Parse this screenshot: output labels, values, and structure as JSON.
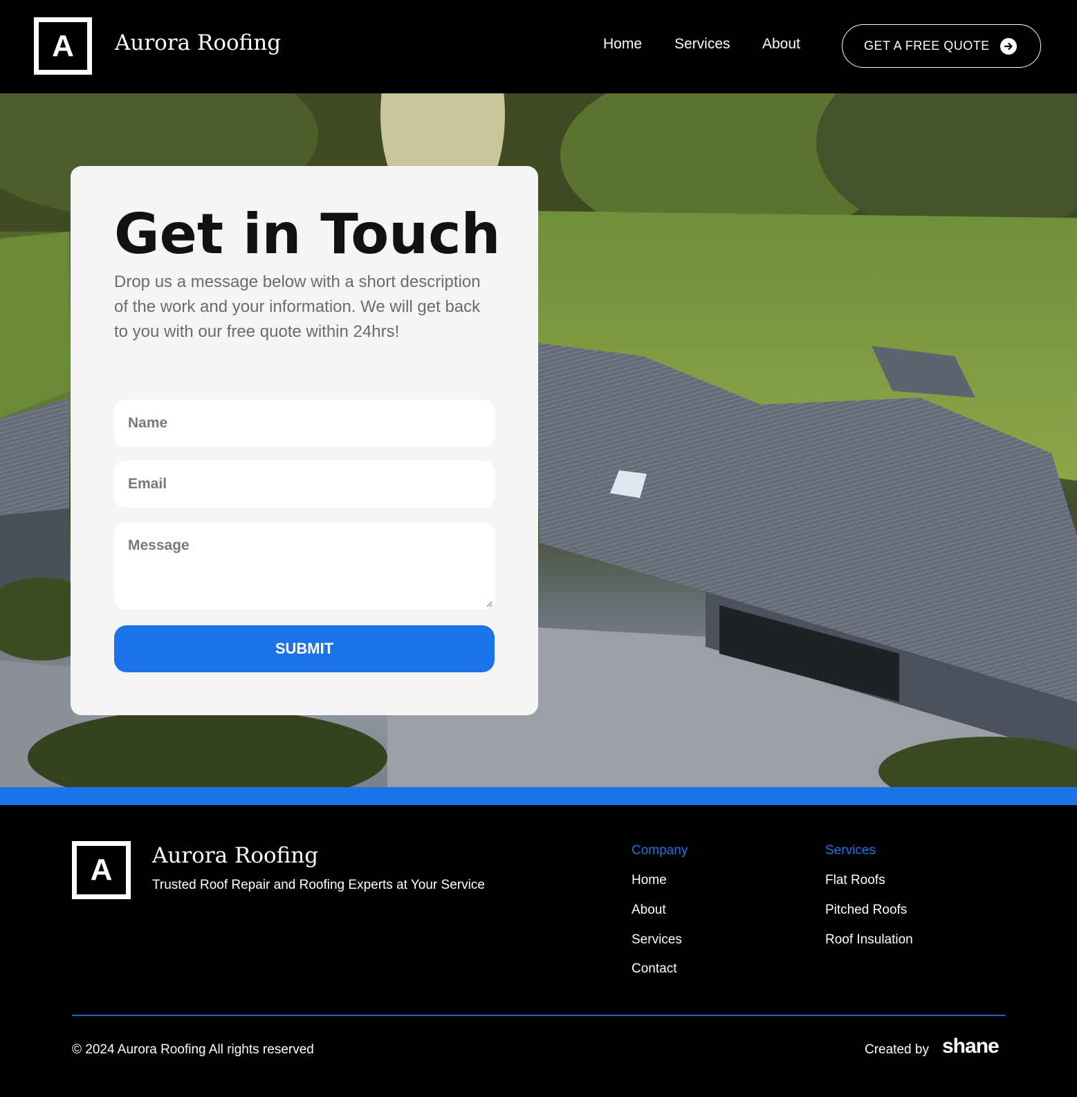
{
  "header": {
    "logo_letter": "A",
    "brand": "Aurora Roofing",
    "nav": [
      "Home",
      "Services",
      "About"
    ],
    "cta_label": "GET A FREE QUOTE",
    "cta_icon": "arrow-right-circle-icon"
  },
  "contact": {
    "title": "Get in Touch",
    "description": "Drop us a message below with a short description of the work and your information. We will get back to you with our free quote within 24hrs!",
    "name_placeholder": "Name",
    "email_placeholder": "Email",
    "message_placeholder": "Message",
    "submit_label": "SUBMIT"
  },
  "footer": {
    "logo_letter": "A",
    "brand": "Aurora Roofing",
    "tagline": "Trusted Roof Repair and Roofing Experts at Your Service",
    "company_heading": "Company",
    "company_links": [
      "Home",
      "About",
      "Services",
      "Contact"
    ],
    "services_heading": "Services",
    "services_links": [
      "Flat Roofs",
      "Pitched Roofs",
      "Roof Insulation"
    ],
    "copyright": "© 2024 Aurora Roofing All rights reserved",
    "created_by": "Created by",
    "creator": "shane"
  },
  "colors": {
    "accent": "#1a73e8",
    "background": "#000000",
    "card": "#f5f5f5"
  }
}
